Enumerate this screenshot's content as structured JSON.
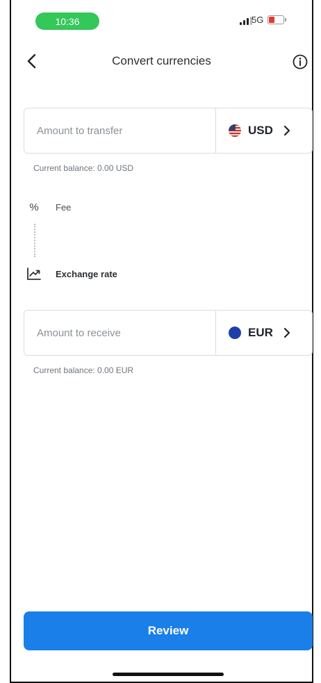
{
  "status_bar": {
    "time": "10:36",
    "network": "5G",
    "battery_color": "#e53935",
    "time_pill_color": "#34c759"
  },
  "header": {
    "title": "Convert currencies",
    "back_icon": "chevron-left-icon",
    "info_icon": "info-icon"
  },
  "transfer": {
    "placeholder": "Amount to transfer",
    "value": "",
    "currency": "USD",
    "flag": "us-flag-icon",
    "balance": "Current balance: 0.00 USD"
  },
  "fee": {
    "label": "Fee",
    "icon": "percent-icon"
  },
  "rate": {
    "label": "Exchange rate",
    "icon": "trend-chart-icon"
  },
  "receive": {
    "placeholder": "Amount to receive",
    "value": "",
    "currency": "EUR",
    "flag": "eu-flag-icon",
    "balance": "Current balance: 0.00 EUR"
  },
  "review": {
    "label": "Review",
    "color": "#1a7fe8"
  }
}
